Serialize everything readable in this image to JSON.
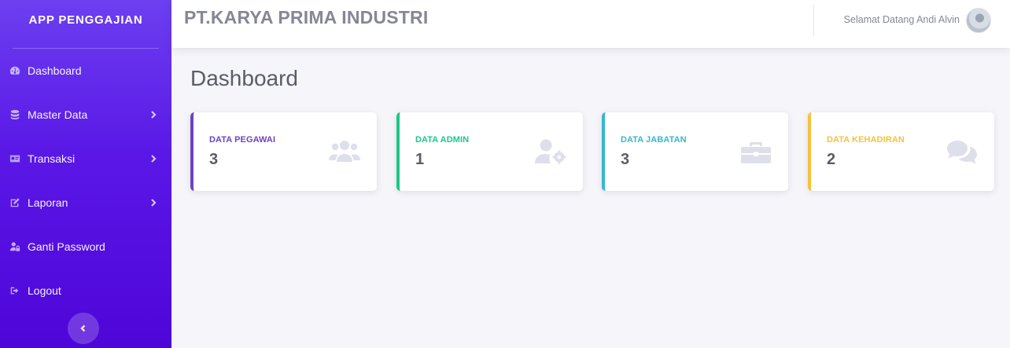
{
  "sidebar": {
    "brand": "APP PENGGAJIAN",
    "items": [
      {
        "label": "Dashboard",
        "icon": "tachometer-icon",
        "has_submenu": false
      },
      {
        "label": "Master Data",
        "icon": "database-icon",
        "has_submenu": true
      },
      {
        "label": "Transaksi",
        "icon": "id-card-icon",
        "has_submenu": true
      },
      {
        "label": "Laporan",
        "icon": "edit-icon",
        "has_submenu": true
      },
      {
        "label": "Ganti Password",
        "icon": "user-lock-icon",
        "has_submenu": false
      },
      {
        "label": "Logout",
        "icon": "sign-out-icon",
        "has_submenu": false
      }
    ]
  },
  "topbar": {
    "company": "PT.KARYA PRIMA INDUSTRI",
    "welcome": "Selamat Datang Andi Alvin"
  },
  "main": {
    "title": "Dashboard",
    "cards": [
      {
        "label": "DATA PEGAWAI",
        "value": "3",
        "color": "#6f42c1",
        "icon": "users-icon"
      },
      {
        "label": "DATA ADMIN",
        "value": "1",
        "color": "#1cc88a",
        "icon": "user-cog-icon"
      },
      {
        "label": "DATA JABATAN",
        "value": "3",
        "color": "#36b9cc",
        "icon": "briefcase-icon"
      },
      {
        "label": "DATA KEHADIRAN",
        "value": "2",
        "color": "#f6c23e",
        "icon": "comments-icon"
      }
    ]
  }
}
